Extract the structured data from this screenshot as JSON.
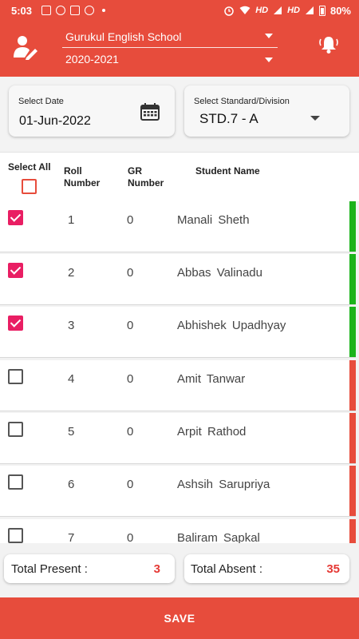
{
  "status_bar": {
    "time": "5:03",
    "network_1": "HD",
    "network_2": "HD",
    "battery": "80%"
  },
  "header": {
    "school": "Gurukul English School",
    "year": "2020-2021",
    "user_icon": "user-edit-icon",
    "bell_icon": "bell-icon"
  },
  "filters": {
    "date_label": "Select Date",
    "date_value": "01-Jun-2022",
    "calendar_icon": "calendar-icon",
    "standard_label": "Select Standard/Division",
    "standard_value": "STD.7 - A"
  },
  "table": {
    "select_all_label": "Select All",
    "roll_header": "Roll Number",
    "gr_header": "GR Number",
    "name_header": "Student Name"
  },
  "students": [
    {
      "roll": "1",
      "gr": "0",
      "name": "Manali  Sheth",
      "present": true
    },
    {
      "roll": "2",
      "gr": "0",
      "name": "Abbas  Valinadu",
      "present": true
    },
    {
      "roll": "3",
      "gr": "0",
      "name": "Abhishek  Upadhyay",
      "present": true
    },
    {
      "roll": "4",
      "gr": "0",
      "name": "Amit  Tanwar",
      "present": false
    },
    {
      "roll": "5",
      "gr": "0",
      "name": "Arpit  Rathod",
      "present": false
    },
    {
      "roll": "6",
      "gr": "0",
      "name": "Ashsih  Sarupriya",
      "present": false
    },
    {
      "roll": "7",
      "gr": "0",
      "name": "Baliram  Sapkal",
      "present": false
    }
  ],
  "totals": {
    "present_label": "Total Present :",
    "present_value": "3",
    "absent_label": "Total Absent :",
    "absent_value": "35"
  },
  "save_label": "SAVE",
  "colors": {
    "primary": "#e74c3c",
    "present": "#1bb31b",
    "absent": "#e74c3c",
    "checkbox": "#e91e63"
  }
}
